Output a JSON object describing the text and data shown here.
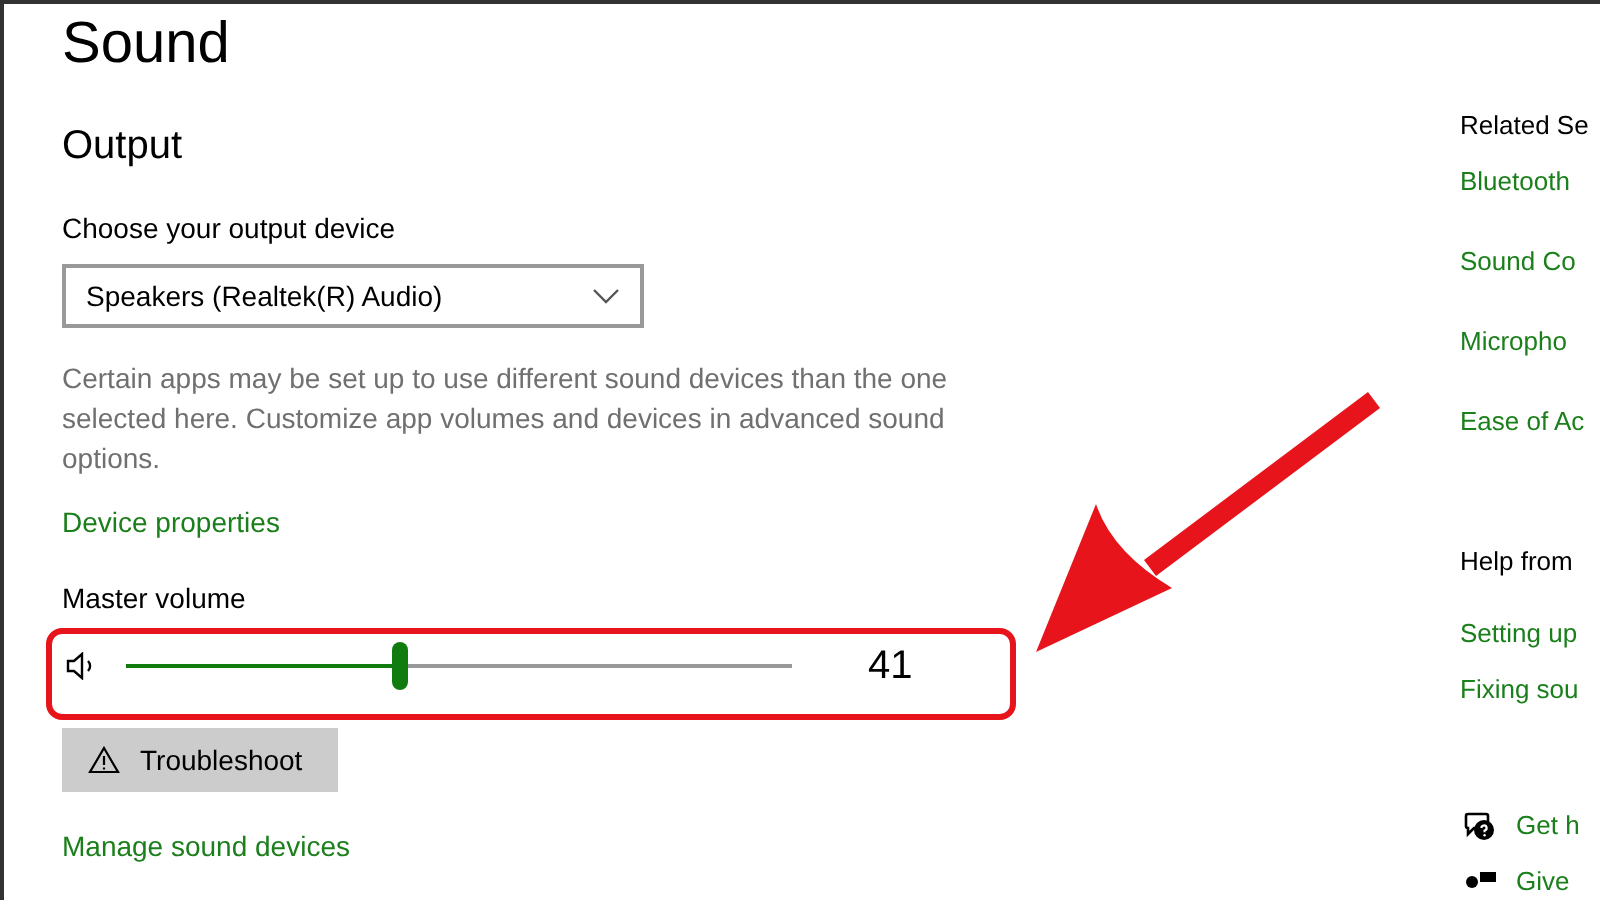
{
  "page_title": "Sound",
  "output": {
    "heading": "Output",
    "device_label": "Choose your output device",
    "device_select": {
      "value": "Speakers (Realtek(R) Audio)"
    },
    "description": "Certain apps may be set up to use different sound devices than the one selected here. Customize app volumes and devices in advanced sound options.",
    "device_properties_link": "Device properties",
    "master_volume": {
      "label": "Master volume",
      "level": 0.41,
      "reading": "41"
    },
    "troubleshoot_button": "Troubleshoot",
    "manage_link": "Manage sound devices"
  },
  "related": {
    "heading": "Related Se",
    "links": [
      "Bluetooth",
      "Sound Co",
      "Micropho",
      "Ease of Ac"
    ]
  },
  "help": {
    "heading": "Help from",
    "links": [
      "Setting up",
      "Fixing sou"
    ]
  },
  "actions": [
    {
      "kind": "get-help",
      "label": "Get h"
    },
    {
      "kind": "feedback",
      "label": "Give"
    }
  ]
}
